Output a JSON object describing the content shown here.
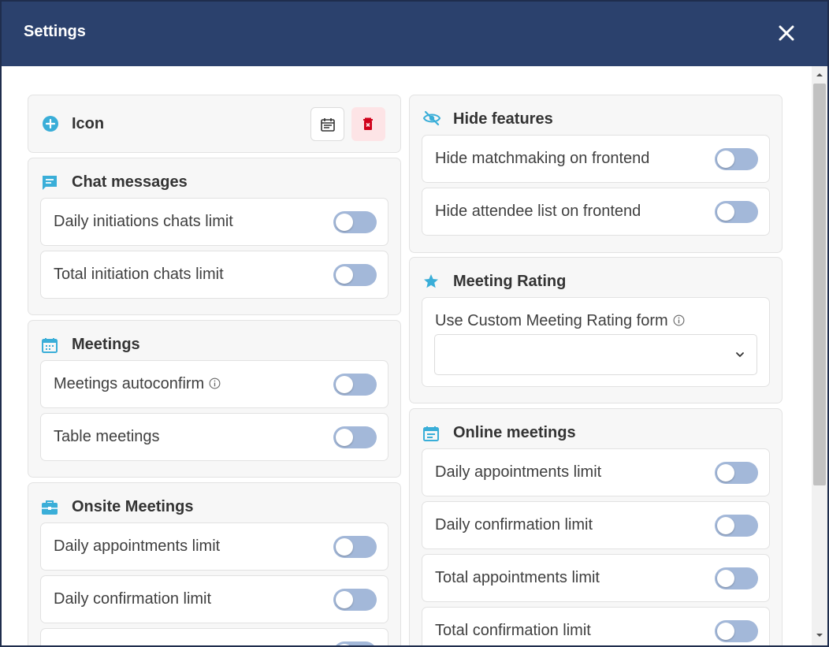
{
  "header": {
    "title": "Settings"
  },
  "icon_section": {
    "title": "Icon"
  },
  "chat_messages": {
    "title": "Chat messages",
    "rows": [
      "Daily initiations chats limit",
      "Total initiation chats limit"
    ]
  },
  "meetings": {
    "title": "Meetings",
    "rows": [
      "Meetings autoconfirm",
      "Table meetings"
    ]
  },
  "onsite_meetings": {
    "title": "Onsite Meetings",
    "rows": [
      "Daily appointments limit",
      "Daily confirmation limit"
    ]
  },
  "hide_features": {
    "title": "Hide features",
    "rows": [
      "Hide matchmaking on frontend",
      "Hide attendee list on frontend"
    ]
  },
  "meeting_rating": {
    "title": "Meeting Rating",
    "field_label": "Use Custom Meeting Rating form",
    "select_value": ""
  },
  "online_meetings": {
    "title": "Online meetings",
    "rows": [
      "Daily appointments limit",
      "Daily confirmation limit",
      "Total appointments limit",
      "Total confirmation limit"
    ]
  },
  "colors": {
    "header": "#2b416d",
    "accent": "#3aaed8",
    "toggle_off": "#a3b8d9",
    "delete_bg": "#fde4e6",
    "delete_icon": "#d0021b"
  }
}
